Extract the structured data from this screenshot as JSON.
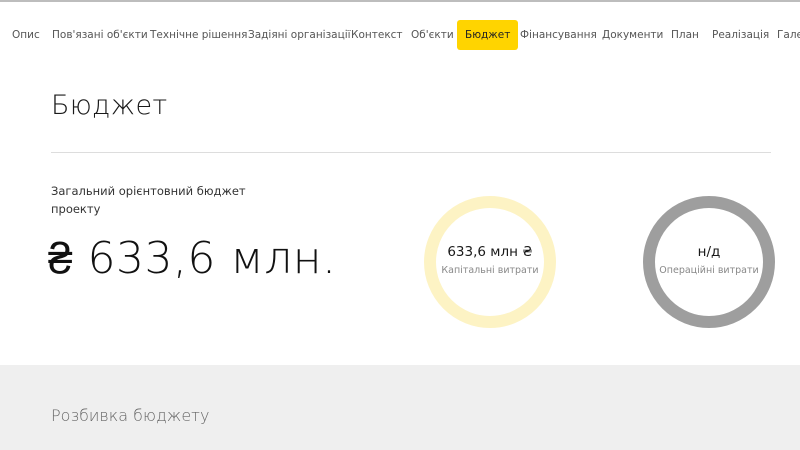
{
  "tabs": [
    {
      "label": "Опис"
    },
    {
      "label": "Пов'язані об'єкти"
    },
    {
      "label": "Технічне рішення"
    },
    {
      "label": "Задіяні організації"
    },
    {
      "label": "Контекст"
    },
    {
      "label": "Об'єкти"
    },
    {
      "label": "Бюджет",
      "active": true
    },
    {
      "label": "Фінансування"
    },
    {
      "label": "Документи"
    },
    {
      "label": "План"
    },
    {
      "label": "Реалізація"
    },
    {
      "label": "Галер"
    }
  ],
  "page": {
    "title": "Бюджет"
  },
  "budget": {
    "label": "Загальний орієнтовний бюджет проекту",
    "total": "₴ 633,6 млн."
  },
  "capex": {
    "value": "633,6 млн ₴",
    "label": "Капітальні витрати",
    "ring_color": "#fdf3c4"
  },
  "opex": {
    "value": "н/д",
    "label": "Операційні витрати",
    "ring_color": "#9e9e9e"
  },
  "breakdown": {
    "title": "Розбивка бюджету"
  },
  "colors": {
    "accent": "#ffd400",
    "section_bg": "#efefef"
  }
}
